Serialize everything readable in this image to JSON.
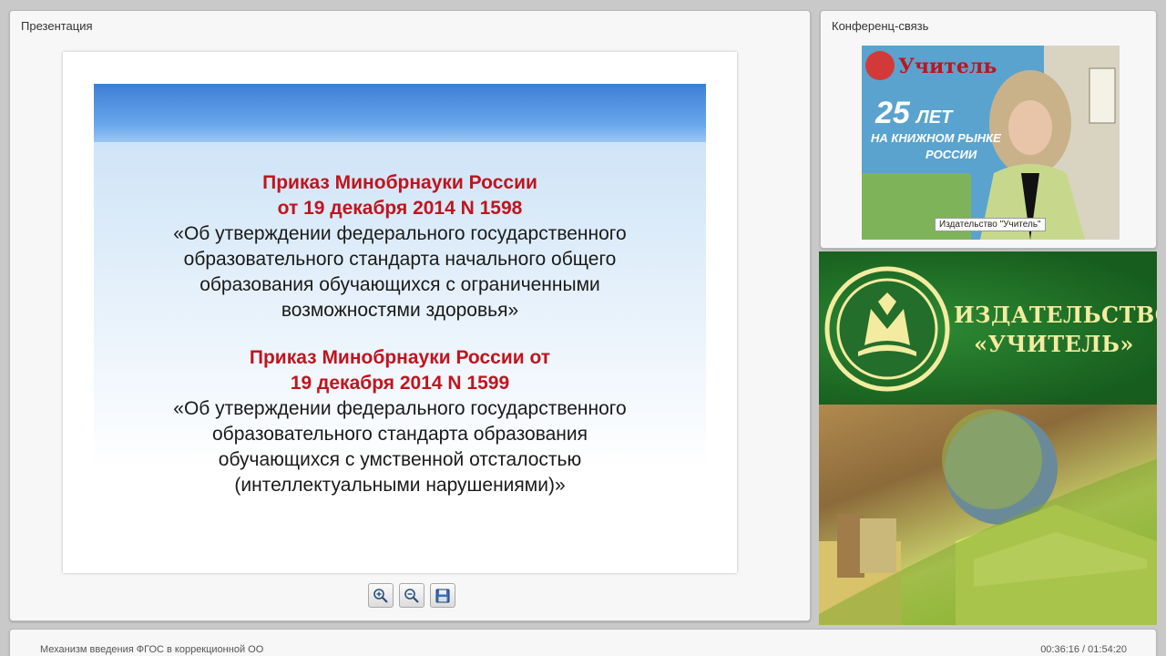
{
  "presentation": {
    "title": "Презентация",
    "slide": {
      "order1_title_line1": "Приказ Минобрнауки России",
      "order1_title_line2": "от 19 декабря 2014  N 1598",
      "order1_desc_line1": "«Об утверждении федерального государственного",
      "order1_desc_line2": "образовательного стандарта начального общего",
      "order1_desc_line3": "образования  обучающихся с ограниченными",
      "order1_desc_line4": "возможностями здоровья»",
      "order2_title_line1": "Приказ Минобрнауки России от",
      "order2_title_line2": "19 декабря 2014  N 1599",
      "order2_desc_line1": "«Об утверждении федерального государственного",
      "order2_desc_line2": "образовательного стандарта образования",
      "order2_desc_line3": "обучающихся с умственной отсталостью",
      "order2_desc_line4": "(интеллектуальными нарушениями)»"
    },
    "toolbar": {
      "zoom_in_icon": "zoom-in-icon",
      "zoom_out_icon": "zoom-out-icon",
      "save_icon": "save-icon"
    }
  },
  "conference": {
    "title": "Конференц-связь",
    "video_caption": "Издательство \"Учитель\"",
    "video_poster_number": "25",
    "video_poster_word1": "ЛЕТ",
    "video_poster_text": "НА КНИЖНОМ РЫНКЕ",
    "video_poster_text2": "РОССИИ",
    "video_poster_brand": "Учитель"
  },
  "logo": {
    "line1": "ИЗДАТЕЛЬСТВО",
    "line2": "«УЧИТЕЛЬ»"
  },
  "bottom_bar": {
    "title": "Механизм введения ФГОС в коррекционной ОО",
    "time": "00:36:16 / 01:54:20"
  },
  "colors": {
    "slide_red": "#c0141e",
    "logo_green": "#1f6e25",
    "logo_gold": "#f3eca0"
  }
}
